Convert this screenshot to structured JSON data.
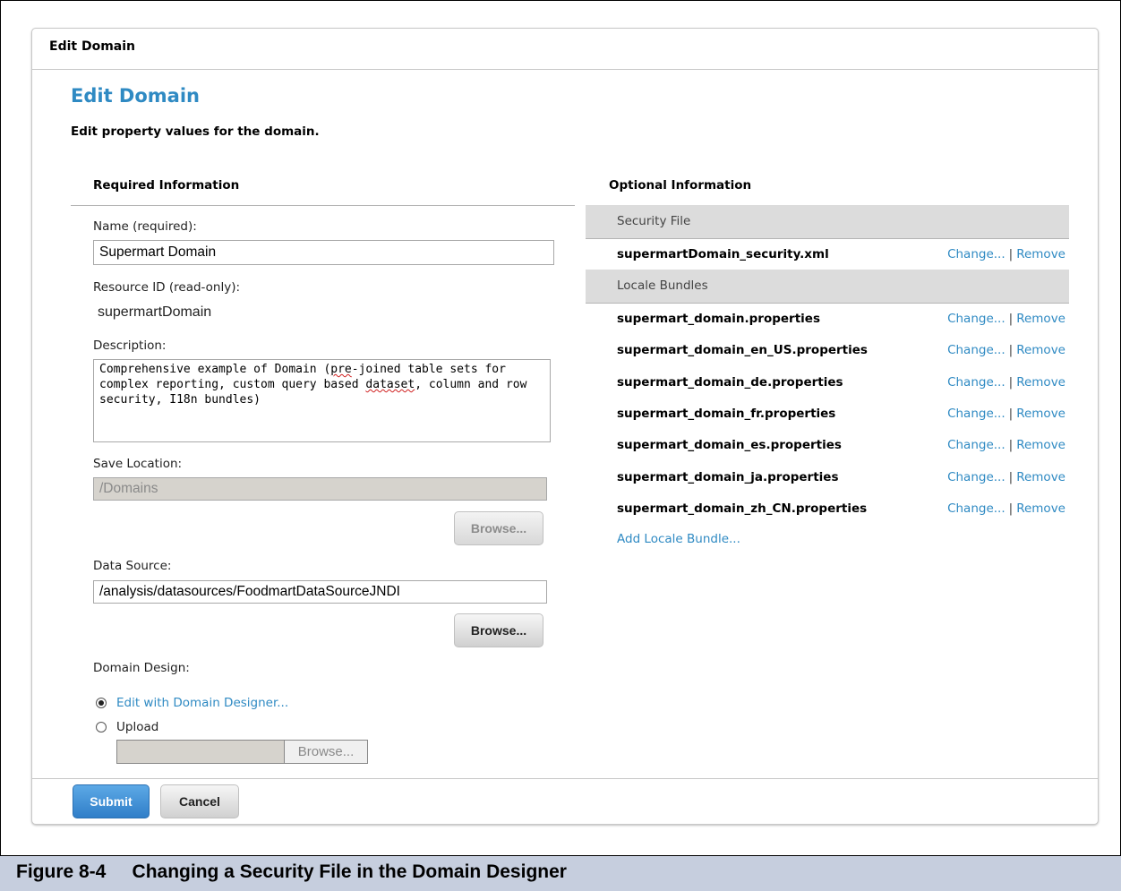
{
  "window": {
    "title": "Edit Domain"
  },
  "page": {
    "title": "Edit Domain",
    "subtitle": "Edit property values for the domain."
  },
  "required": {
    "section_title": "Required Information",
    "name_label": "Name (required):",
    "name_value": "Supermart Domain",
    "resource_id_label": "Resource ID (read-only):",
    "resource_id_value": "supermartDomain",
    "description_label": "Description:",
    "description_parts": [
      "Comprehensive example of Domain (",
      "pre",
      "-joined table sets for\ncomplex reporting, custom query based ",
      "dataset",
      ", column and row\nsecurity, I18n bundles)"
    ],
    "save_location_label": "Save Location:",
    "save_location_value": "/Domains",
    "browse_label": "Browse...",
    "data_source_label": "Data Source:",
    "data_source_value": "/analysis/datasources/FoodmartDataSourceJNDI",
    "domain_design_label": "Domain Design:",
    "design_option_edit": "Edit with Domain Designer...",
    "design_option_upload": "Upload",
    "upload_browse_label": "Browse..."
  },
  "optional": {
    "section_title": "Optional Information",
    "security_file_header": "Security File",
    "security_file": "supermartDomain_security.xml",
    "locale_bundles_header": "Locale Bundles",
    "locale_bundles": [
      "supermart_domain.properties",
      "supermart_domain_en_US.properties",
      "supermart_domain_de.properties",
      "supermart_domain_fr.properties",
      "supermart_domain_es.properties",
      "supermart_domain_ja.properties",
      "supermart_domain_zh_CN.properties"
    ],
    "change_label": "Change...",
    "separator": "|",
    "remove_label": "Remove",
    "add_locale_label": "Add Locale Bundle..."
  },
  "footer": {
    "submit_label": "Submit",
    "cancel_label": "Cancel"
  },
  "caption": {
    "text": "Figure 8-4     Changing a Security File in the Domain Designer"
  },
  "colors": {
    "accent": "#2f8ac3",
    "submit": "#3a8ad6",
    "caption_bg": "#c6cede"
  }
}
